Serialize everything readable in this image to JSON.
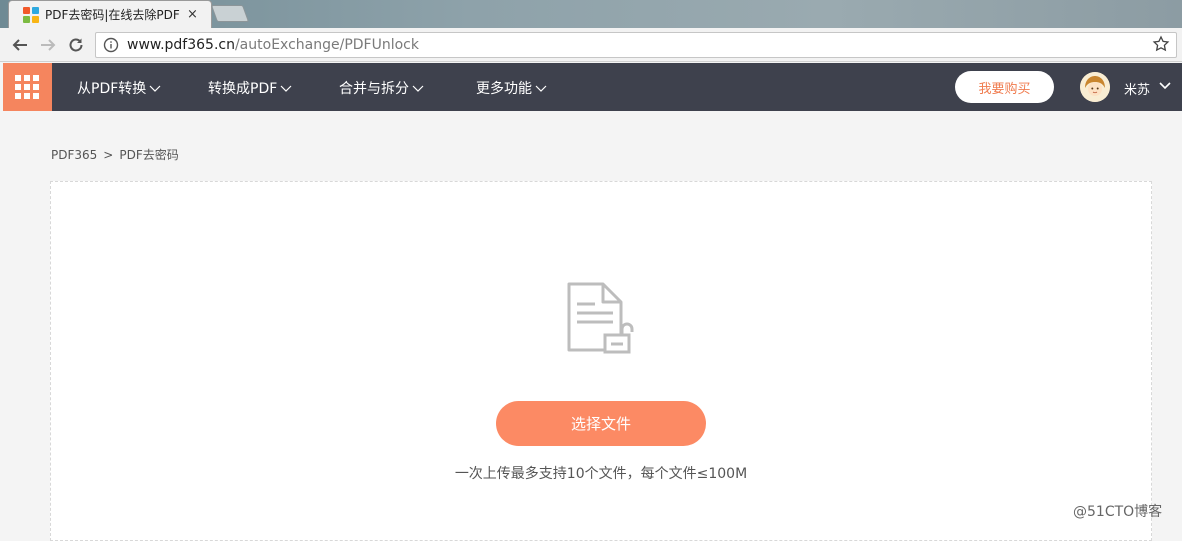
{
  "browser": {
    "tab_title": "PDF去密码|在线去除PDF",
    "tab_close": "×",
    "url_host": "www.pdf365.cn",
    "url_path": "/autoExchange/PDFUnlock"
  },
  "header": {
    "menu": [
      {
        "label": "从PDF转换"
      },
      {
        "label": "转换成PDF"
      },
      {
        "label": "合并与拆分"
      },
      {
        "label": "更多功能"
      }
    ],
    "buy_label": "我要购买",
    "username": "米苏"
  },
  "breadcrumb": {
    "home": "PDF365",
    "separator": ">",
    "current": "PDF去密码"
  },
  "upload": {
    "button_label": "选择文件",
    "hint": "一次上传最多支持10个文件，每个文件≤100M"
  },
  "watermark": "@51CTO博客",
  "colors": {
    "accent": "#fc8a64",
    "nav_bg": "#3e414d",
    "grid_bg": "#f5855e"
  }
}
